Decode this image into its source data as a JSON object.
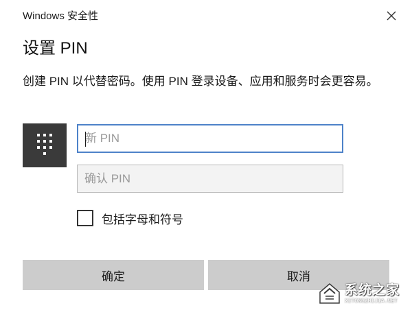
{
  "window": {
    "app_title": "Windows 安全性",
    "close_icon": "close-icon"
  },
  "dialog": {
    "title": "设置 PIN",
    "description": "创建 PIN 以代替密码。使用 PIN 登录设备、应用和服务时会更容易。",
    "pin_icon": "keypad-icon"
  },
  "form": {
    "new_pin_placeholder": "新 PIN",
    "confirm_pin_placeholder": "确认 PIN",
    "include_letters_label": "包括字母和符号",
    "include_letters_checked": false
  },
  "buttons": {
    "ok_label": "确定",
    "cancel_label": "取消"
  },
  "watermark": {
    "title": "系统之家",
    "url": "XITONGZHIJIA.NET"
  },
  "colors": {
    "focus_border": "#4d82c9",
    "icon_tile": "#3a3a3a",
    "button_bg": "#cccccc"
  }
}
